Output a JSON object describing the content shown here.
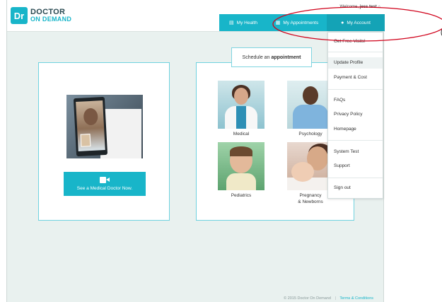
{
  "logo": {
    "mark": "Dr",
    "line1": "DOCTOR",
    "line2": "ON DEMAND"
  },
  "header": {
    "welcome_prefix": "Welcome,",
    "user_name": "jess test",
    "home_icon": "home-icon"
  },
  "nav": {
    "health": {
      "label": "My Health",
      "icon": "document-icon"
    },
    "appointments": {
      "label": "My Appointments",
      "icon": "calendar-icon"
    },
    "account": {
      "label": "My Account",
      "icon": "person-icon"
    }
  },
  "account_menu": {
    "items": [
      "Get Free Visits!",
      "Update Profile",
      "Payment & Cost",
      "FAQs",
      "Privacy Policy",
      "Homepage",
      "System Test",
      "Support",
      "Sign out"
    ],
    "highlighted": "Update Profile"
  },
  "main": {
    "see_doctor_button": "See a Medical Doctor Now.",
    "camera_icon": "video-camera-icon",
    "schedule_prefix": "Schedule an",
    "schedule_emphasis": "appointment",
    "categories": [
      {
        "label": "Medical"
      },
      {
        "label": "Psychology"
      },
      {
        "label": "Pediatrics"
      },
      {
        "label_line1": "Pregnancy",
        "label_line2": "& Newborns"
      }
    ]
  },
  "footer": {
    "copyright": "© 2015 Doctor On Demand",
    "separator": "|",
    "terms": "Terms & Conditions"
  },
  "colors": {
    "accent": "#18b5c9",
    "page_bg": "#e9f1ef",
    "annotation": "#d0021b"
  }
}
